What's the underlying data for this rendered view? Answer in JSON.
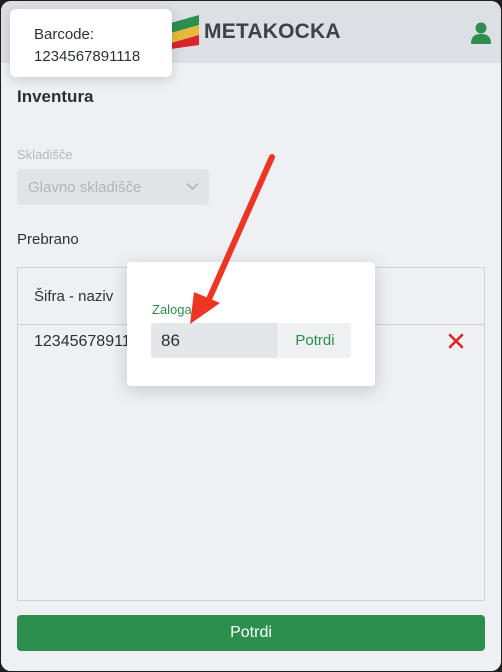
{
  "header": {
    "brand": "METAKOCKA",
    "user_icon": "user-icon",
    "colors": {
      "header_bg": "#dcdfe4",
      "brand_text": "#3d4148",
      "user_icon": "#2c8f4e"
    }
  },
  "page": {
    "title": "Inventura",
    "warehouse": {
      "label": "Skladišče",
      "value": "Glavno skladišče"
    },
    "counted_label": "Prebrano",
    "table": {
      "columns": [
        "Šifra - naziv"
      ],
      "rows": [
        {
          "code": "12345678911"
        }
      ]
    },
    "confirm_label": "Potrdi",
    "colors": {
      "accent": "#2c8f4e",
      "delete": "#d9262c"
    }
  },
  "modal": {
    "label": "Zaloga",
    "input_value": "86",
    "button_label": "Potrdi"
  },
  "tooltip": {
    "label": "Barcode:",
    "value": "1234567891118"
  },
  "annotation": {
    "arrow_color": "#ee3524"
  }
}
